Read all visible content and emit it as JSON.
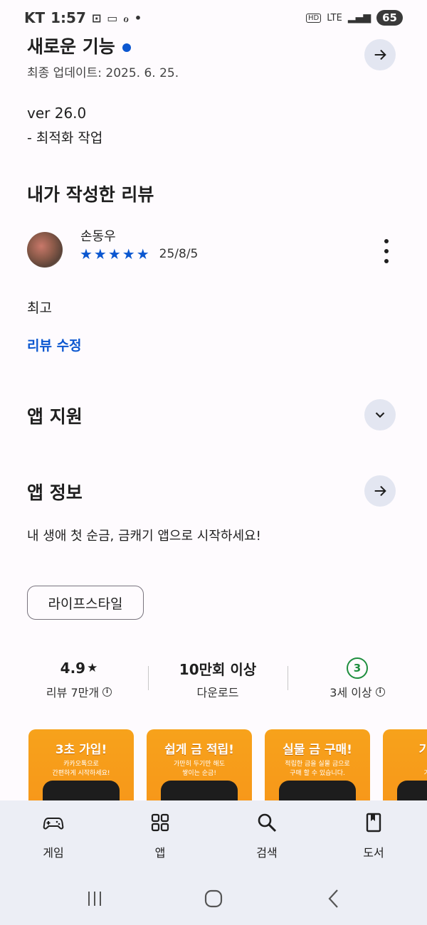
{
  "status_bar": {
    "carrier": "KT",
    "time": "1:57",
    "network": "LTE",
    "hd": "HD",
    "battery": "65"
  },
  "whats_new": {
    "title": "새로운 기능",
    "last_updated": "최종 업데이트: 2025. 6. 25.",
    "version": "ver 26.0",
    "notes": "- 최적화 작업"
  },
  "my_review": {
    "heading": "내가 작성한 리뷰",
    "author": "손동우",
    "stars": "★★★★★",
    "rating": 5,
    "date": "25/8/5",
    "text": "최고",
    "edit_label": "리뷰 수정"
  },
  "app_support": {
    "heading": "앱 지원"
  },
  "app_info": {
    "heading": "앱 정보",
    "description": "내 생애 첫 순금, 금캐기 앱으로 시작하세요!",
    "category_chip": "라이프스타일"
  },
  "stats": {
    "rating_value": "4.9",
    "rating_star": "★",
    "rating_label": "리뷰 7만개",
    "downloads_value": "10만회 이상",
    "downloads_label": "다운로드",
    "age_badge": "3",
    "age_label": "3세 이상"
  },
  "screenshots": [
    {
      "title": "3초 가입!",
      "subtitle_1": "카카오톡으로",
      "subtitle_2": "간편하게 시작하세요!"
    },
    {
      "title": "쉽게 금 적립!",
      "subtitle_1": "가만히 두기만 해도",
      "subtitle_2": "쌓이는 순금!"
    },
    {
      "title": "실물 금 구매!",
      "subtitle_1": "적립한 금을 실물 금으로",
      "subtitle_2": "구매 할 수 있습니다."
    },
    {
      "title": "기프티",
      "subtitle_1": "적립한",
      "subtitle_2": "기프티콘"
    }
  ],
  "bottom_nav": {
    "games": "게임",
    "apps": "앱",
    "search": "검색",
    "books": "도서"
  },
  "colors": {
    "accent": "#0b57d0",
    "age_green": "#1e8e3e",
    "screenshot_orange": "#f7a21b"
  }
}
